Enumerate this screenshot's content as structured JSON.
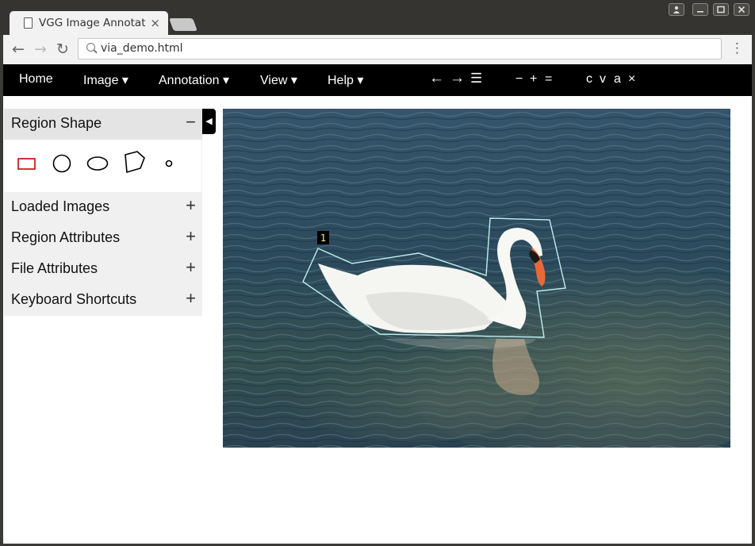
{
  "browser": {
    "tab_title": "VGG Image Annotator",
    "tab_close": "×",
    "url": "via_demo.html",
    "nav": {
      "back": "←",
      "forward": "→",
      "reload": "↻",
      "menu": "⋮"
    },
    "window_controls": {
      "user": "👤",
      "minimize": "—",
      "maximize": "☐",
      "close": "✕"
    }
  },
  "menubar": {
    "home": "Home",
    "image": "Image ▾",
    "annotation": "Annotation ▾",
    "view": "View ▾",
    "help": "Help ▾",
    "prev": "←",
    "next": "→",
    "list": "☰",
    "zoom_out": "−",
    "zoom_in": "+",
    "zoom_reset": "=",
    "copy": "c",
    "paste": "v",
    "select_all": "a",
    "delete": "×"
  },
  "left_panel": {
    "region_shape": {
      "label": "Region Shape",
      "toggle": "−"
    },
    "shapes": [
      "rectangle-icon",
      "circle-icon",
      "ellipse-icon",
      "polygon-icon",
      "point-icon"
    ],
    "selected_shape": "rectangle",
    "sections": [
      {
        "label": "Loaded Images",
        "toggle": "+"
      },
      {
        "label": "Region Attributes",
        "toggle": "+"
      },
      {
        "label": "File Attributes",
        "toggle": "+"
      },
      {
        "label": "Keyboard Shortcuts",
        "toggle": "+"
      }
    ],
    "collapse": "◀"
  },
  "canvas": {
    "region_label": "1",
    "region_color": "#bff0f0",
    "water_color": "#2d4a5a",
    "selected_shape_color": "#cc0000"
  }
}
